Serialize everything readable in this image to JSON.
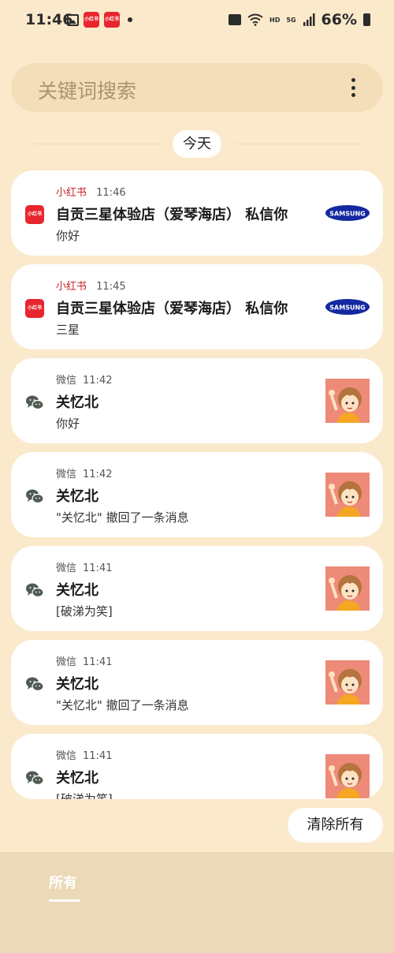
{
  "status_bar": {
    "time": "11:46",
    "app_icon_text": "小红书",
    "network_hd": "HD",
    "network_5g": "5G",
    "battery": "66%"
  },
  "search": {
    "placeholder": "关键词搜索"
  },
  "date_header": "今天",
  "notifications": [
    {
      "app": "小红书",
      "time": "11:46",
      "title": "自贡三星体验店（爱琴海店） 私信你",
      "body": "你好",
      "app_icon": "xiaohongshu-icon",
      "thumb": "samsung-logo",
      "thumb_text": "SAMSUNG",
      "icon_text": "小红书"
    },
    {
      "app": "小红书",
      "time": "11:45",
      "title": "自贡三星体验店（爱琴海店） 私信你",
      "body": "三星",
      "app_icon": "xiaohongshu-icon",
      "thumb": "samsung-logo",
      "thumb_text": "SAMSUNG",
      "icon_text": "小红书"
    },
    {
      "app": "微信",
      "time": "11:42",
      "title": "关忆北",
      "body": "你好",
      "app_icon": "wechat-icon",
      "thumb": "avatar-girl"
    },
    {
      "app": "微信",
      "time": "11:42",
      "title": "关忆北",
      "body": "\"关忆北\" 撤回了一条消息",
      "app_icon": "wechat-icon",
      "thumb": "avatar-girl"
    },
    {
      "app": "微信",
      "time": "11:41",
      "title": "关忆北",
      "body": "[破涕为笑]",
      "app_icon": "wechat-icon",
      "thumb": "avatar-girl"
    },
    {
      "app": "微信",
      "time": "11:41",
      "title": "关忆北",
      "body": "\"关忆北\" 撤回了一条消息",
      "app_icon": "wechat-icon",
      "thumb": "avatar-girl"
    },
    {
      "app": "微信",
      "time": "11:41",
      "title": "关忆北",
      "body": "[破涕为笑]",
      "app_icon": "wechat-icon",
      "thumb": "avatar-girl"
    }
  ],
  "clear_all_label": "清除所有",
  "bottom_tab": "所有",
  "colors": {
    "background": "#fbe9cb",
    "xiaohongshu_red": "#e8262f",
    "samsung_blue": "#1428a0"
  }
}
